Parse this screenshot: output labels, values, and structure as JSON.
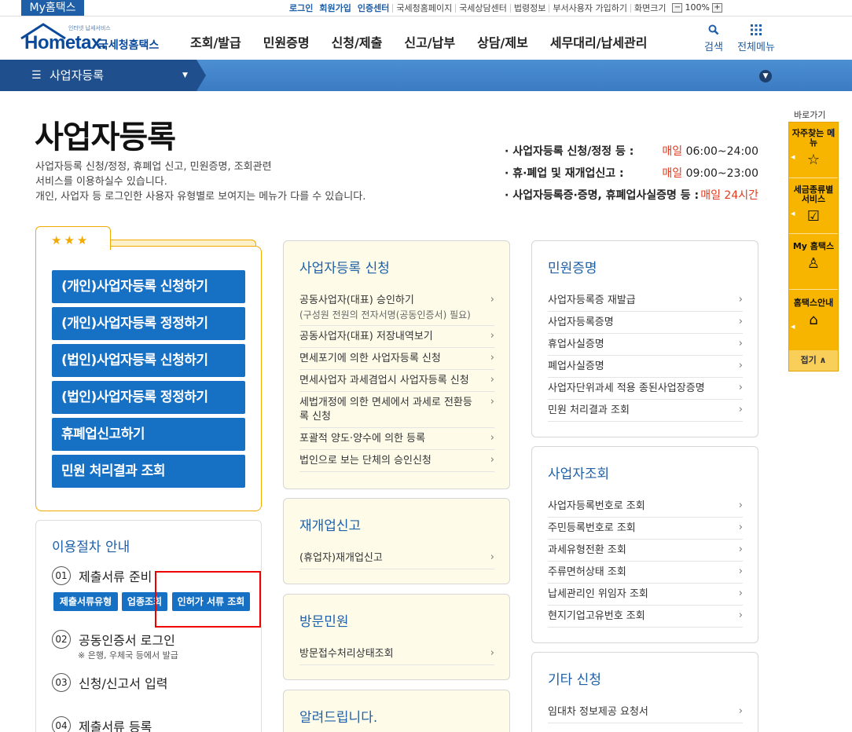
{
  "topbar": {
    "my_tab": "My홈택스",
    "links": [
      "로그인",
      "회원가입",
      "인증센터",
      "국세청홈페이지",
      "국세상담센터",
      "법령정보",
      "부서사용자 가입하기",
      "화면크기"
    ],
    "zoom_minus": "−",
    "zoom_value": "100%",
    "zoom_plus": "+"
  },
  "header": {
    "logo_small": "인터넷 납세서비스",
    "logo_text": "Hometax.",
    "logo_kr": "국세청홈택스",
    "nav": [
      "조회/발급",
      "민원증명",
      "신청/제출",
      "신고/납부",
      "상담/제보",
      "세무대리/납세관리"
    ],
    "search_label": "검색",
    "allmenu_label": "전체메뉴"
  },
  "location": {
    "current": "사업자등록"
  },
  "title": {
    "heading": "사업자등록",
    "desc_lines": [
      "사업자등록 신청/정정, 휴폐업 신고, 민원증명, 조회관련",
      "서비스를 이용하실수 있습니다.",
      "개인, 사업자 등 로그인한 사용자 유형별로 보여지는 메뉴가 다를 수 있습니다."
    ]
  },
  "hours": [
    {
      "label": "· 사업자등록 신청/정정 등 :",
      "prefix": "매일",
      "time": " 06:00~24:00"
    },
    {
      "label": "· 휴·폐업 및 재개업신고 :",
      "prefix": "매일",
      "time": " 09:00~23:00"
    },
    {
      "label": "· 사업자등록증·증명, 휴폐업사실증명 등 :",
      "prefix": "매일",
      "time": " 24시간"
    }
  ],
  "quick": {
    "stars": "★★★",
    "buttons": [
      "(개인)사업자등록 신청하기",
      "(개인)사업자등록 정정하기",
      "(법인)사업자등록 신청하기",
      "(법인)사업자등록 정정하기",
      "휴폐업신고하기",
      "민원 처리결과 조회"
    ]
  },
  "procedure": {
    "title": "이용절차 안내",
    "steps": [
      {
        "num": "01",
        "label": "제출서류 준비"
      },
      {
        "num": "02",
        "label": "공동인증서 로그인"
      },
      {
        "num": "03",
        "label": "신청/신고서 입력"
      },
      {
        "num": "04",
        "label": "제출서류 등록"
      }
    ],
    "step2_note": "※ 은행, 우체국 등에서 발급",
    "buttons": [
      "제출서류유형",
      "업종조회",
      "인허가 서류 조회"
    ]
  },
  "panels": {
    "biz_apply": {
      "title": "사업자등록 신청",
      "items": [
        {
          "label": "공동사업자(대표) 승인하기",
          "sub": "(구성원 전원의 전자서명(공동인증서) 필요)"
        },
        {
          "label": "공동사업자(대표) 저장내역보기",
          "sub": ""
        },
        {
          "label": "면세포기에 의한 사업자등록 신청",
          "sub": ""
        },
        {
          "label": "면세사업자 과세겸업시 사업자등록 신청",
          "sub": ""
        },
        {
          "label": "세법개정에 의한 면세에서 과세로 전환등록 신청",
          "sub": ""
        },
        {
          "label": "포괄적 양도·양수에 의한 등록",
          "sub": ""
        },
        {
          "label": "법인으로 보는 단체의 승인신청",
          "sub": ""
        }
      ]
    },
    "reopen": {
      "title": "재개업신고",
      "items": [
        {
          "label": "(휴업자)재개업신고",
          "sub": ""
        }
      ]
    },
    "visit": {
      "title": "방문민원",
      "items": [
        {
          "label": "방문접수처리상태조회",
          "sub": ""
        }
      ]
    },
    "notice": {
      "title": "알려드립니다.",
      "items": []
    },
    "certificate": {
      "title": "민원증명",
      "items": [
        {
          "label": "사업자등록증 재발급",
          "sub": ""
        },
        {
          "label": "사업자등록증명",
          "sub": ""
        },
        {
          "label": "휴업사실증명",
          "sub": ""
        },
        {
          "label": "폐업사실증명",
          "sub": ""
        },
        {
          "label": "사업자단위과세 적용 종된사업장증명",
          "sub": ""
        },
        {
          "label": "민원 처리결과 조회",
          "sub": ""
        }
      ]
    },
    "lookup": {
      "title": "사업자조회",
      "items": [
        {
          "label": "사업자등록번호로 조회",
          "sub": ""
        },
        {
          "label": "주민등록번호로 조회",
          "sub": ""
        },
        {
          "label": "과세유형전환 조회",
          "sub": ""
        },
        {
          "label": "주류면허상태 조회",
          "sub": ""
        },
        {
          "label": "납세관리인 위임자 조회",
          "sub": ""
        },
        {
          "label": "현지기업고유번호 조회",
          "sub": ""
        }
      ]
    },
    "etc": {
      "title": "기타 신청",
      "items": [
        {
          "label": "임대차 정보제공 요청서",
          "sub": ""
        }
      ]
    }
  },
  "quickbar": {
    "label": "바로가기",
    "items": [
      {
        "label": "자주찾는 메뉴",
        "icon": "star-icon"
      },
      {
        "label": "세금종류별 서비스",
        "icon": "checkbox-icon"
      },
      {
        "label": "My 홈택스",
        "icon": "user-icon"
      },
      {
        "label": "홈택스안내",
        "icon": "house-icon"
      }
    ],
    "close": "접기 ∧"
  },
  "colors": {
    "brand_blue": "#1670c4",
    "accent_orange": "#f2a900",
    "time_red": "#e23a1f",
    "highlight_red": "#ee0000"
  }
}
